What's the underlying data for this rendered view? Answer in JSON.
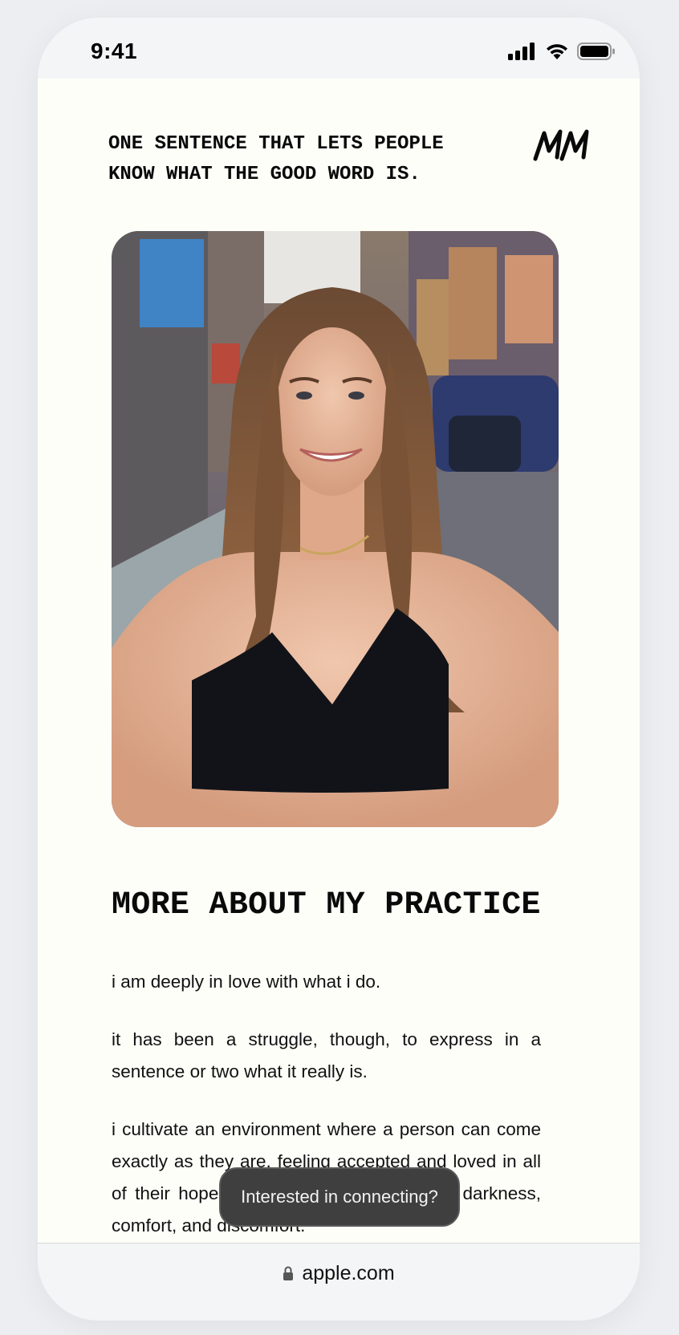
{
  "status_bar": {
    "time": "9:41",
    "icons": [
      "signal-icon",
      "wifi-icon",
      "battery-icon"
    ]
  },
  "header": {
    "tagline": "ONE SENTENCE THAT LETS PEOPLE KNOW WHAT THE GOOD WORD IS.",
    "logo_text": "MM"
  },
  "hero": {
    "image": "portrait-photo"
  },
  "section": {
    "title": "MORE ABOUT MY PRACTICE",
    "paragraphs": [
      "i am deeply in love with what i do.",
      "it has been a struggle, though, to express in a sentence or two what it really is.",
      "i cultivate an environment where a person can come exactly as they are, feeling accepted and loved in all of their hopes, fears, desires, brightness, darkness, comfort, and discomfort."
    ]
  },
  "toast": {
    "label": "Interested in connecting?"
  },
  "browser": {
    "url": "apple.com"
  },
  "colors": {
    "page_bg": "#fdfef8",
    "chrome_bg": "#f4f5f6",
    "text": "#0a0a0a",
    "toast_bg": "#3f3f3f"
  }
}
